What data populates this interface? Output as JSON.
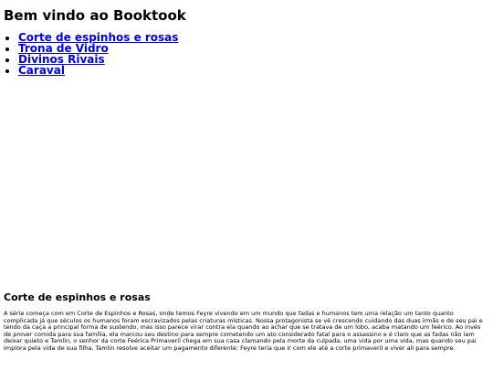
{
  "header": {
    "title": "Bem vindo ao Booktook"
  },
  "nav": {
    "items": [
      {
        "label": "Corte de espinhos e rosas"
      },
      {
        "label": "Trona de Vidro"
      },
      {
        "label": "Divinos Rivais"
      },
      {
        "label": "Caraval"
      }
    ]
  },
  "section": {
    "title": "Corte de espinhos e rosas",
    "body": "A série começa com em Corte de Espinhos e Rosas, onde temos Feyre vivendo em um mundo que fadas e humanos tem uma relação um tanto quanto complicada já que séculos os humanos foram escravizados pelas criaturas místicas. Nossa protagonista se vê crescendo cuidando das duas irmãs e de seu pai e tendo da caça a principal forma de sustendo, mas isso parece virar contra ela quando ao achar que se tratava de um lobo, acaba matando um feérico. Ao invés de prover comida para sua família, ela marcou seu destino para sempre cometendo um ato considerado fatal para o assassino e é claro que as fadas não iam deixar quieto e Tamlin, o senhor da corte Feérica Primaveril chega em sua casa clamando pela morte da culpada, uma vida por uma vida, mas quando seu pai implora pela vida de sua filha, Tamlin resolve aceitar um pagamento diferente: Feyre teria que ir com ele até a corte primaveril e viver ali para sempre."
  }
}
